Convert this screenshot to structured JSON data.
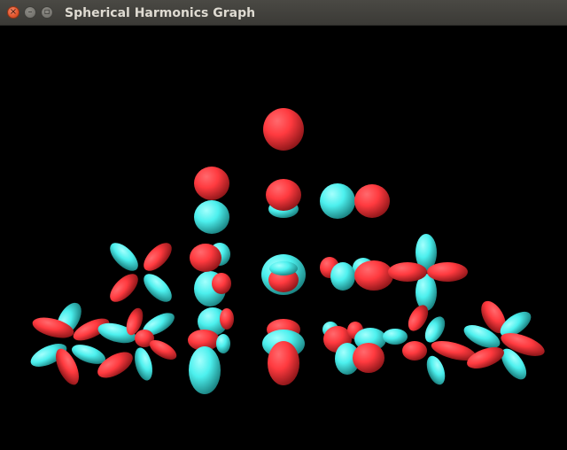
{
  "window": {
    "title": "Spherical Harmonics Graph",
    "close_glyph": "×",
    "minimize_glyph": "–",
    "maximize_glyph": "▫"
  },
  "colors": {
    "positive_lobe": "#ff3a3f",
    "negative_lobe": "#4cf0ee",
    "background": "#000000",
    "titlebar": "#3c3b37"
  },
  "chart_data": {
    "type": "3d-surface",
    "description_rows": [
      {
        "l": 0,
        "orbitals": [
          "Y00"
        ]
      },
      {
        "l": 1,
        "orbitals": [
          "Y1-1",
          "Y10",
          "Y11"
        ]
      },
      {
        "l": 2,
        "orbitals": [
          "Y2-2",
          "Y2-1",
          "Y20",
          "Y21",
          "Y22"
        ]
      },
      {
        "l": 3,
        "orbitals": [
          "Y3-3",
          "Y3-2",
          "Y3-1",
          "Y30",
          "Y31",
          "Y32",
          "Y33"
        ]
      }
    ]
  }
}
